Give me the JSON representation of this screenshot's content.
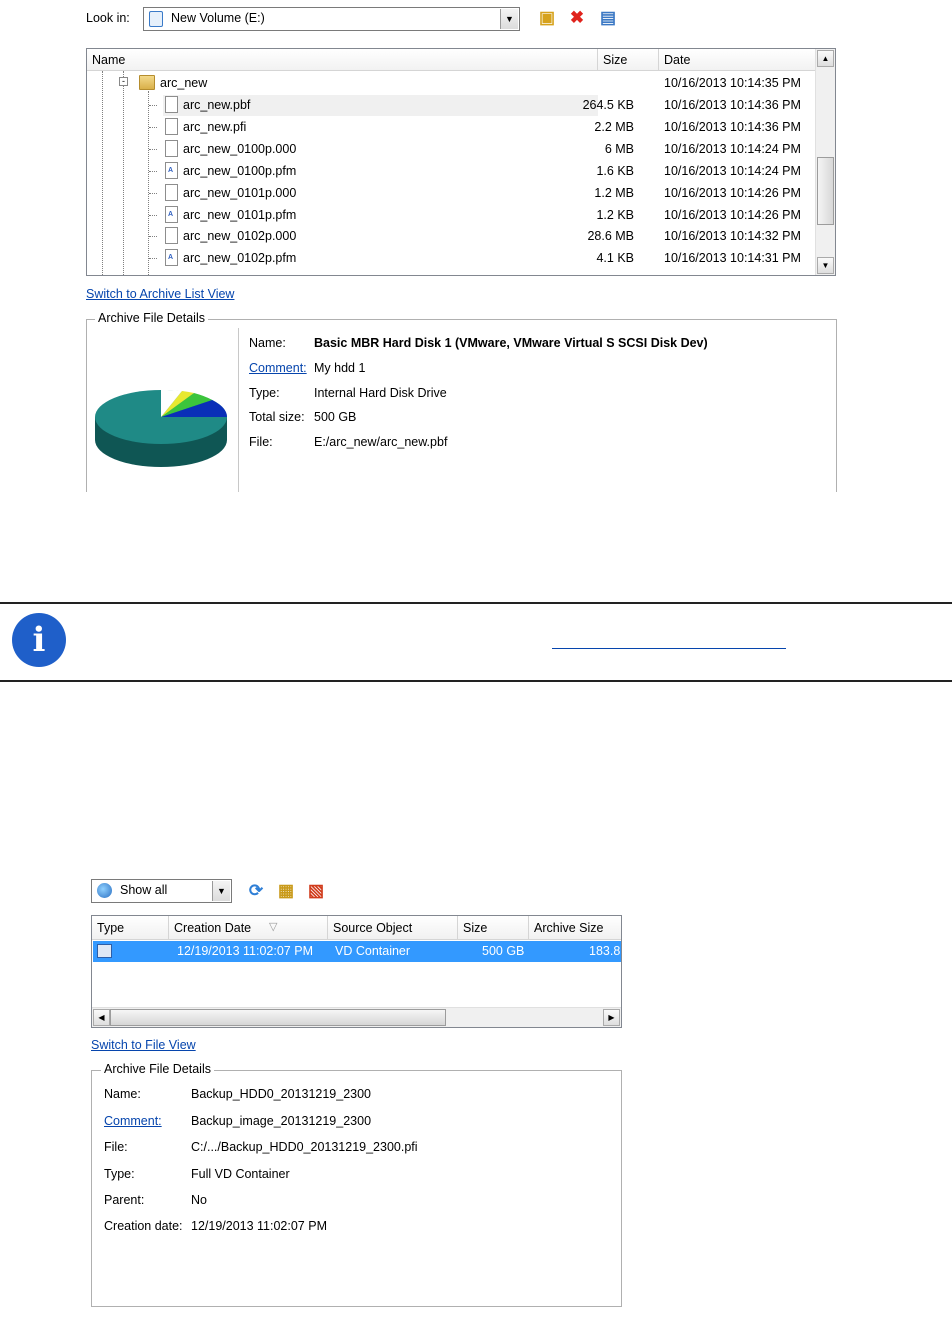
{
  "top_dialog": {
    "look_in_label": "Look in:",
    "look_in_value": "New Volume (E:)",
    "columns": [
      "Name",
      "Size",
      "Date"
    ],
    "folder": {
      "name": "arc_new",
      "date": "10/16/2013 10:14:35 PM"
    },
    "files": [
      {
        "name": "arc_new.pbf",
        "size": "264.5 KB",
        "date": "10/16/2013 10:14:36 PM",
        "icon": "file-icon"
      },
      {
        "name": "arc_new.pfi",
        "size": "2.2 MB",
        "date": "10/16/2013 10:14:36 PM",
        "icon": "file-icon"
      },
      {
        "name": "arc_new_0100p.000",
        "size": "6 MB",
        "date": "10/16/2013 10:14:24 PM",
        "icon": "file-icon"
      },
      {
        "name": "arc_new_0100p.pfm",
        "size": "1.6 KB",
        "date": "10/16/2013 10:14:24 PM",
        "icon": "pfm-file-icon"
      },
      {
        "name": "arc_new_0101p.000",
        "size": "1.2 MB",
        "date": "10/16/2013 10:14:26 PM",
        "icon": "file-icon"
      },
      {
        "name": "arc_new_0101p.pfm",
        "size": "1.2 KB",
        "date": "10/16/2013 10:14:26 PM",
        "icon": "pfm-file-icon"
      },
      {
        "name": "arc_new_0102p.000",
        "size": "28.6 MB",
        "date": "10/16/2013 10:14:32 PM",
        "icon": "file-icon"
      },
      {
        "name": "arc_new_0102p.pfm",
        "size": "4.1 KB",
        "date": "10/16/2013 10:14:31 PM",
        "icon": "pfm-file-icon"
      }
    ],
    "switch_link": "Switch to Archive List View",
    "details_title": "Archive File Details",
    "details": {
      "name_label": "Name:",
      "name_value": "Basic MBR Hard Disk 1 (VMware, VMware Virtual S SCSI Disk Dev)",
      "comment_label": "Comment:",
      "comment_value": "My hdd 1",
      "type_label": "Type:",
      "type_value": "Internal Hard Disk Drive",
      "size_label": "Total size:",
      "size_value": "500 GB",
      "file_label": "File:",
      "file_value": "E:/arc_new/arc_new.pbf"
    },
    "colors": {
      "pie_main": "#1f8a86",
      "pie_blue": "#0a2fb8",
      "pie_yellow": "#e8e830",
      "pie_green": "#3cc43c"
    }
  },
  "note": {
    "icon": "info-icon",
    "accent": "#1f5fc9"
  },
  "bottom_dialog": {
    "filter_value": "Show all",
    "columns": [
      "Type",
      "Creation Date",
      "Source Object",
      "Size",
      "Archive Size"
    ],
    "row": {
      "type_icon": "vd-container-icon",
      "creation_date": "12/19/2013 11:02:07 PM",
      "source_object": "VD Container",
      "size": "500 GB",
      "archive_size": "183.8"
    },
    "switch_link": "Switch to File View",
    "details_title": "Archive File Details",
    "details": [
      {
        "label": "Name:",
        "value": "Backup_HDD0_20131219_2300",
        "link": false
      },
      {
        "label": "Comment:",
        "value": "Backup_image_20131219_2300",
        "link": true
      },
      {
        "label": "File:",
        "value": "C:/.../Backup_HDD0_20131219_2300.pfi",
        "link": false
      },
      {
        "label": "Type:",
        "value": "Full VD Container",
        "link": false
      },
      {
        "label": "Parent:",
        "value": "No",
        "link": false
      },
      {
        "label": "Creation date:",
        "value": "12/19/2013 11:02:07 PM",
        "link": false
      }
    ],
    "selection_color": "#3399ff"
  }
}
